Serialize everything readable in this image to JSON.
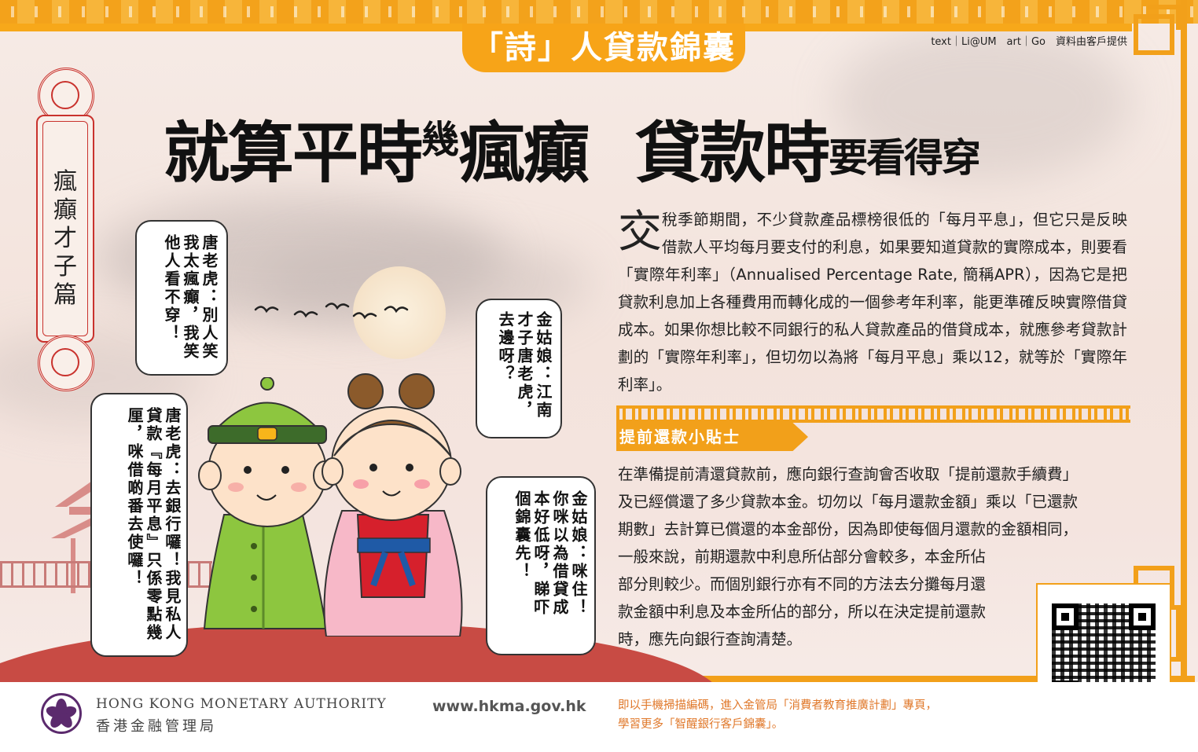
{
  "header": {
    "badge": "「詩」人貸款錦囊",
    "credits": "text｜Li@UM　art｜Go　資料由客戶提供"
  },
  "headline": {
    "part1_big": "就算平時",
    "part1_small": "幾",
    "part1_end": "瘋癲",
    "part2_big": "貸款時",
    "part2_small": "要看得穿"
  },
  "scroll": {
    "title": "瘋癲才子篇"
  },
  "bubbles": [
    {
      "text": "唐老虎：別人笑\n我太瘋癲，我笑\n他人看不穿！"
    },
    {
      "text": "金姑娘：江南\n才子唐老虎，\n去邊呀？"
    },
    {
      "text": "唐老虎：去銀行囉！我見私人\n貸款『每月平息』只係零點幾\n厘，咪借啲番去使囉！"
    },
    {
      "text": "金姑娘：咪住！\n你咪以為借貸成\n本好低呀，睇吓\n個錦囊先！"
    }
  ],
  "article": {
    "dropcap": "交",
    "body": "稅季節期間，不少貸款產品標榜很低的「每月平息」，但它只是反映借款人平均每月要支付的利息，如果要知道貸款的實際成本，則要看「實際年利率」（Annualised Percentage Rate, 簡稱APR），因為它是把貸款利息加上各種費用而轉化成的一個參考年利率，能更準確反映實際借貸成本。如果你想比較不同銀行的私人貸款產品的借貸成本，就應參考貸款計劃的「實際年利率」，但切勿以為將「每月平息」乘以12，就等於「實際年利率」。"
  },
  "tips": {
    "heading": "提前還款小貼士",
    "lines": [
      "在準備提前清還貸款前，應向銀行查詢會否收取「提前還款手續費」",
      "及已經償還了多少貸款本金。切勿以「每月還款金額」乘以「已還款",
      "期數」去計算已償還的本金部份，因為即使每個月還款的金額相同，",
      "一般來說，前期還款中利息所佔部分會較多，本金所佔",
      "部分則較少。而個別銀行亦有不同的方法去分攤每月還",
      "款金額中利息及本金所佔的部分，所以在決定提前還款",
      "時，應先向銀行查詢清楚。"
    ]
  },
  "footer": {
    "org_en": "HONG KONG MONETARY AUTHORITY",
    "org_zh": "香港金融管理局",
    "url": "www.hkma.gov.hk",
    "note_line1": "即以手機掃描編碼，進入金管局「消費者教育推廣計劃」專頁，",
    "note_line2": "學習更多「智醒銀行客戶錦囊」。"
  },
  "colors": {
    "accent_orange": "#f2a01a",
    "red": "#c9322d",
    "hkma_purple": "#5b2a6d"
  }
}
